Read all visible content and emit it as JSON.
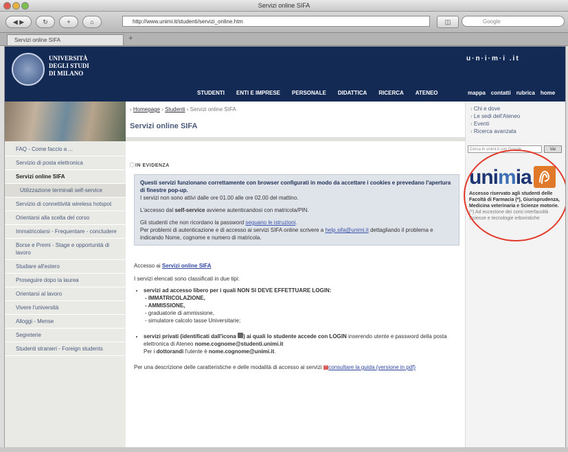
{
  "window": {
    "title": "Servizi online SIFA"
  },
  "browser": {
    "url": "http://www.unimi.it/studenti/servizi_online.htm",
    "search_placeholder": "Google",
    "tab_label": "Servizi online SIFA",
    "back": "◀ ▶",
    "reload": "↻",
    "add": "+",
    "home": "⌂",
    "new_tab": "+"
  },
  "header": {
    "university": [
      "UNIVERSITÀ",
      "DEGLI STUDI",
      "DI MILANO"
    ],
    "site_logo": "u·n·i·m·i .it",
    "nav": [
      "STUDENTI",
      "ENTI E IMPRESE",
      "PERSONALE",
      "DIDATTICA",
      "RICERCA",
      "ATENEO"
    ],
    "utility_nav": [
      "mappa",
      "contatti",
      "rubrica",
      "home"
    ]
  },
  "left_nav": [
    {
      "label": "FAQ - Come faccio a ...",
      "active": false,
      "sub": false
    },
    {
      "label": "Servizio di posta elettronica",
      "active": false,
      "sub": false
    },
    {
      "label": "Servizi online SIFA",
      "active": true,
      "sub": false
    },
    {
      "label": "Utilizzazione terminali self-service",
      "active": false,
      "sub": true
    },
    {
      "label": "Servizio di connettività wireless hotspot",
      "active": false,
      "sub": false
    },
    {
      "label": "Orientarsi alla scelta del corso",
      "active": false,
      "sub": false
    },
    {
      "label": "Immatricolarsi - Frequentare - concludere",
      "active": false,
      "sub": false
    },
    {
      "label": "Borse e Premi - Stage e opportunità di lavoro",
      "active": false,
      "sub": false
    },
    {
      "label": "Studiare all'estero",
      "active": false,
      "sub": false
    },
    {
      "label": "Proseguire dopo la laurea",
      "active": false,
      "sub": false
    },
    {
      "label": "Orientarsi al lavoro",
      "active": false,
      "sub": false
    },
    {
      "label": "Vivere l'università",
      "active": false,
      "sub": false
    },
    {
      "label": "Alloggi - Mense",
      "active": false,
      "sub": false
    },
    {
      "label": "Segreterie",
      "active": false,
      "sub": false
    },
    {
      "label": "Studenti stranieri - Foreign students",
      "active": false,
      "sub": false
    }
  ],
  "breadcrumb": {
    "home": "Homepage",
    "section": "Studenti",
    "current": "Servizi online SIFA"
  },
  "main": {
    "title": "Servizi online SIFA",
    "evidenza_label": "IN EVIDENZA",
    "note": {
      "bold_line": "Questi servizi funzionano correttamente con browser configurati in modo da accettare i cookies e prevedano l'apertura di finestre pop-up.",
      "hours": "I servizi non sono attivi dalle ore 01.00 alle ore 02.00 del mattino.",
      "self_service_pre": "L'accesso dal ",
      "self_service_bold": "self-service",
      "self_service_post": " avviene autenticandosi con matricola/PIN.",
      "password_pre": "Gli studenti che non ricordano la password ",
      "password_link": "seguano le istruzioni",
      "password_post": ".",
      "problems_pre": "Per problemi di autenticazione e di accesso ai servizi SIFA online scrivere a ",
      "problems_link": "help.sifa@unimi.it",
      "problems_post": " dettagliando il problema e indicando Nome, cognome e numero di matricola."
    },
    "access_pre": "Accesso ai ",
    "access_link": "Servizi online SIFA",
    "intro": "I servizi elencati sono classificati in due tipi:",
    "free_services_bold": "servizi ad accesso libero per i quali NON SI DEVE EFFETTUARE LOGIN:",
    "free_items": [
      "- IMMATRICOLAZIONE,",
      "- AMMISSIONE,",
      "- graduatorie di ammissione,",
      "- simulatore calcolo tasse Universitarie;"
    ],
    "private_bold": "servizi privati (identificati dall'icona",
    "private_bold2": ") ai quali lo studente accede con LOGIN",
    "private_rest": " inserendo utente e password della posta elettronica di Ateneo ",
    "private_email": "nome.cognome@studenti.unimi.it",
    "phd_pre": "Per i ",
    "phd_bold": "dottorandi",
    "phd_mid": " l'utente è ",
    "phd_email": "nome.cognome@unimi.it",
    "phd_post": ".",
    "guide_pre": "Per una descrizione delle caratteristiche e delle modalità di accesso ai servizi ",
    "guide_link": "consultare la guida (versione in pdf)"
  },
  "right": {
    "quick_links": [
      "Chi e dove",
      "Le sedi dell'Ateneo",
      "Eventi",
      "Ricerca avanzata"
    ],
    "search_placeholder": "Cerca in unimi.it con Google",
    "search_button": "Vai",
    "unimia_pre": "uni",
    "unimia_mid": "m",
    "unimia_post": "ia",
    "unimia_bold": "Accesso riservato agli studenti delle Facoltà di Farmacia (*), Giurisprudenza, Medicina veterinaria e Scienze motorie.",
    "unimia_rest": " (*) Ad eccezione dei corsi interfacoltà Scienze e tecnologie erboristiche"
  },
  "colors": {
    "header_bg": "#132a55",
    "annotation_circle": "#e23b2c",
    "unimia_badge": "#e07a2a"
  }
}
